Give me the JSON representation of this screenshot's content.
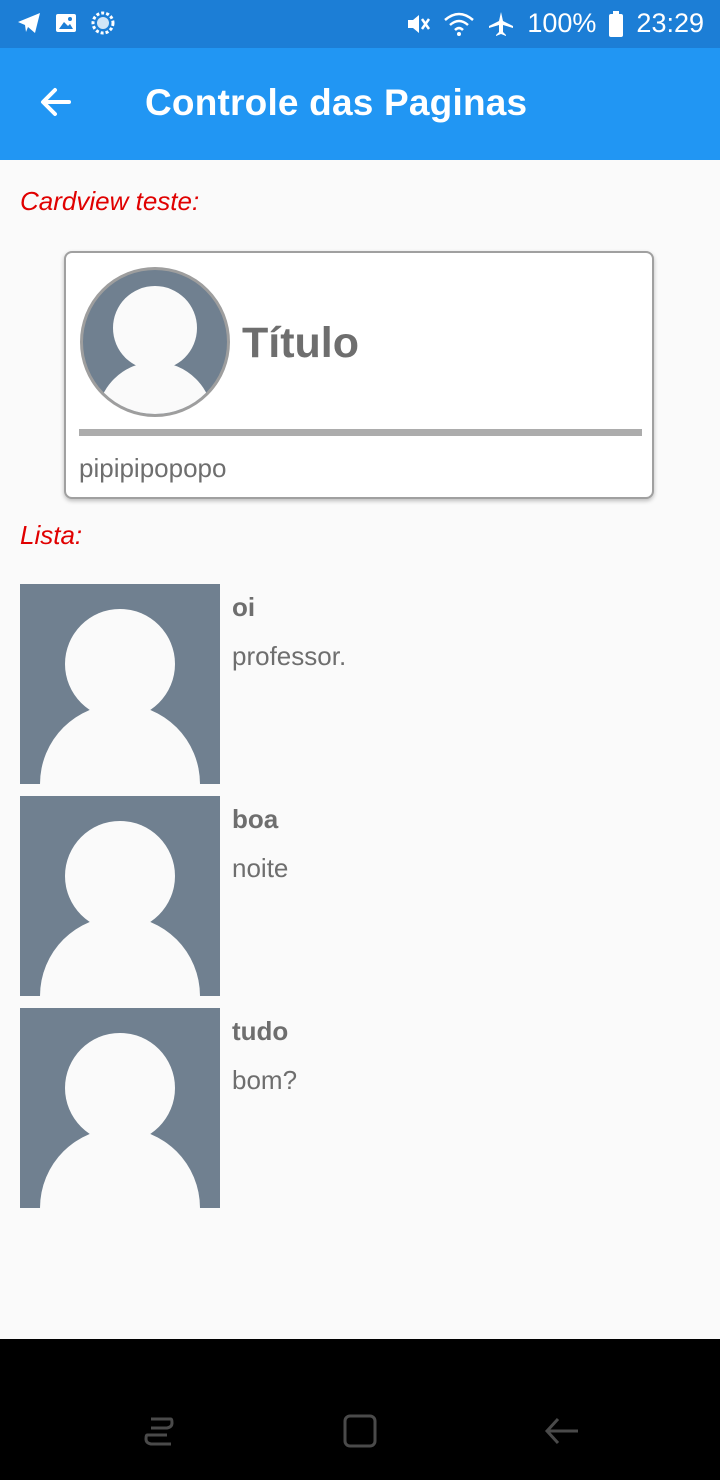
{
  "status_bar": {
    "icons_left": [
      "telegram-icon",
      "gallery-icon",
      "sync-icon"
    ],
    "icons_right": [
      "mute-icon",
      "wifi-icon",
      "airplane-icon",
      "battery-icon"
    ],
    "battery": "100%",
    "time": "23:29"
  },
  "app_bar": {
    "title": "Controle das Paginas",
    "back_icon": "arrow-left-icon",
    "color": "#2196f3"
  },
  "card_section": {
    "label": "Cardview teste:",
    "card": {
      "title": "Título",
      "text": "pipipipopopo",
      "avatar_icon": "avatar-placeholder-icon"
    }
  },
  "list_section": {
    "label": "Lista:",
    "items": [
      {
        "title": "oi",
        "subtitle": "professor."
      },
      {
        "title": "boa",
        "subtitle": "noite"
      },
      {
        "title": "tudo",
        "subtitle": "bom?"
      }
    ]
  },
  "nav_bar": {
    "buttons": [
      "recents-icon",
      "home-icon",
      "back-icon"
    ]
  },
  "colors": {
    "status_bar": "#1c7ed6",
    "label_red": "#e00000",
    "placeholder": "#708090",
    "text_gray": "#6e6e6e"
  }
}
